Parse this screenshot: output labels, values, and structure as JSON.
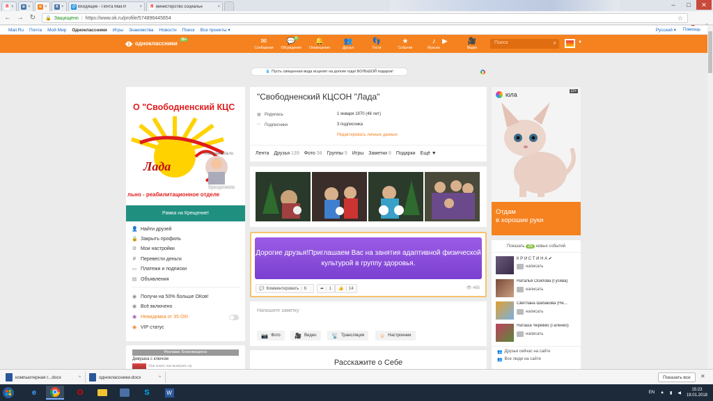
{
  "browser": {
    "tabs": [
      {
        "icon": "yandex",
        "title": "",
        "color": "#e00"
      },
      {
        "icon": "vk",
        "title": "",
        "color": "#4a76a8"
      },
      {
        "icon": "ok",
        "title": "",
        "color": "#f5821f"
      },
      {
        "icon": "k",
        "title": "",
        "color": "#4a76a8"
      },
      {
        "icon": "mail",
        "title": "Входящие - Почта Mail.R",
        "color": "#168de2"
      },
      {
        "icon": "yandex",
        "title": "министерство социальн",
        "color": "#e00"
      }
    ],
    "secure_label": "Защищено",
    "url": "https://www.ok.ru/profile/574896445654",
    "yandex_btn": "Я"
  },
  "portal": {
    "links": [
      "Mail.Ru",
      "Почта",
      "Мой Мир",
      "Одноклассники",
      "Игры",
      "Знакомства",
      "Новости",
      "Поиск",
      "Все проекты ▾"
    ],
    "language": "Русский ▾",
    "help": "Помощь"
  },
  "ok_header": {
    "logo_text": "одноклассники",
    "age_badge": "16+",
    "nav": [
      {
        "label": "Сообщения",
        "icon": "✉",
        "badge": ""
      },
      {
        "label": "Обсуждения",
        "icon": "💬",
        "badge": "8"
      },
      {
        "label": "Оповещения",
        "icon": "🔔",
        "badge": ""
      },
      {
        "label": "Друзья",
        "icon": "👥",
        "badge": ""
      },
      {
        "label": "Гости",
        "icon": "👣",
        "badge": ""
      },
      {
        "label": "События",
        "icon": "★",
        "badge": ""
      },
      {
        "label": "Музыка",
        "icon": "♪",
        "badge": ""
      },
      {
        "label": "",
        "icon": "▶",
        "badge": ""
      },
      {
        "label": "Видео",
        "icon": "🎥",
        "badge": ""
      }
    ],
    "search_placeholder": "Поиск"
  },
  "promo": {
    "text": "Пусть священная вода исцелит на долгие года! БОЛЬШОЙ подарок!"
  },
  "left": {
    "avatar_text_top": "О \"Свободненский КЦС",
    "avatar_text_lada": "Лада",
    "avatar_text_bottom": "льно - реабилитационное отделе",
    "avatar_watermark": "Крещением",
    "avatar_watermark2": "Krasnaatsica.ru",
    "ramka": "Рамка на Крещение!",
    "menu": [
      {
        "icon": "👤",
        "label": "Найти друзей"
      },
      {
        "icon": "🔒",
        "label": "Закрыть профиль"
      },
      {
        "icon": "⚙",
        "label": "Мои настройки"
      },
      {
        "icon": "₽",
        "label": "Перевести деньги"
      },
      {
        "icon": "▭",
        "label": "Платежи и подписки"
      },
      {
        "icon": "▤",
        "label": "Объявления"
      }
    ],
    "menu2": [
      {
        "icon": "◉",
        "label": "Получи на 50% больше ОКов!"
      },
      {
        "icon": "◉",
        "label": "Всё включено"
      },
      {
        "icon": "◉",
        "label": "Невидимка от 35 ОК!"
      },
      {
        "icon": "◉",
        "label": "VIP статус"
      }
    ],
    "ad_label": "Реклама: Благовещенск",
    "ad_title": "Девушка с ключом",
    "ad_sub": "Она знает, как выиграть ор"
  },
  "profile": {
    "name": "\"Свободненский КЦСОН \"Лада\"",
    "born_label": "Родилась",
    "born_value": "1 января 1970 (48 лет)",
    "subs_label": "Подписчики",
    "subs_value": "3 подписчика",
    "edit": "Редактировать личные данные",
    "tabs": [
      {
        "label": "Лента",
        "count": ""
      },
      {
        "label": "Друзья",
        "count": "139"
      },
      {
        "label": "Фото",
        "count": "58"
      },
      {
        "label": "Группы",
        "count": "5"
      },
      {
        "label": "Игры",
        "count": ""
      },
      {
        "label": "Заметки",
        "count": "8"
      },
      {
        "label": "Подарки",
        "count": ""
      },
      {
        "label": "Ещё ▼",
        "count": ""
      }
    ]
  },
  "post": {
    "text": "Дорогие друзья!Приглашаем Вас на занятия адаптивной физической культурой в группу здоровья.",
    "comment": "Комментировать",
    "comment_count": "6",
    "share_count": "1",
    "like_count": "14",
    "views": "465"
  },
  "note": {
    "placeholder": "Напишите заметку",
    "buttons": [
      {
        "icon": "📷",
        "label": "Фото"
      },
      {
        "icon": "🎥",
        "label": "Видео"
      },
      {
        "icon": "📡",
        "label": "Трансляция"
      },
      {
        "icon": "☺",
        "label": "Настроение"
      }
    ]
  },
  "tell": {
    "title": "Расскажите о Себе"
  },
  "right": {
    "ad_brand": "юла",
    "ad_age": "12+",
    "ad_offer_line1": "Отдам",
    "ad_offer_line2": "в хорошие руки",
    "events_prefix": "Показать",
    "events_count": "25",
    "events_suffix": "новых событий",
    "friends": [
      {
        "name": "К Р И С Т И Н А ✔",
        "action": "написать"
      },
      {
        "name": "Наталья Осипова (Гусева)",
        "action": "написать"
      },
      {
        "name": "Светлана Шабакова (Не...",
        "action": "написать"
      },
      {
        "name": "Наташа Черевко (Галенко)",
        "action": "написать"
      }
    ],
    "link_online": "Друзья сейчас на сайте",
    "link_all": "Все люди на сайте"
  },
  "downloads": {
    "items": [
      "компьютерная г...docx",
      "одноклассники.docx"
    ],
    "show_all": "Показать все"
  },
  "taskbar": {
    "lang": "EN",
    "time": "15:23",
    "date": "19.01.2018"
  },
  "colors": {
    "accent": "#f5821f",
    "teal": "#1f8f80",
    "purple": "#8a4ddb",
    "green_badge": "#8bc34a"
  }
}
